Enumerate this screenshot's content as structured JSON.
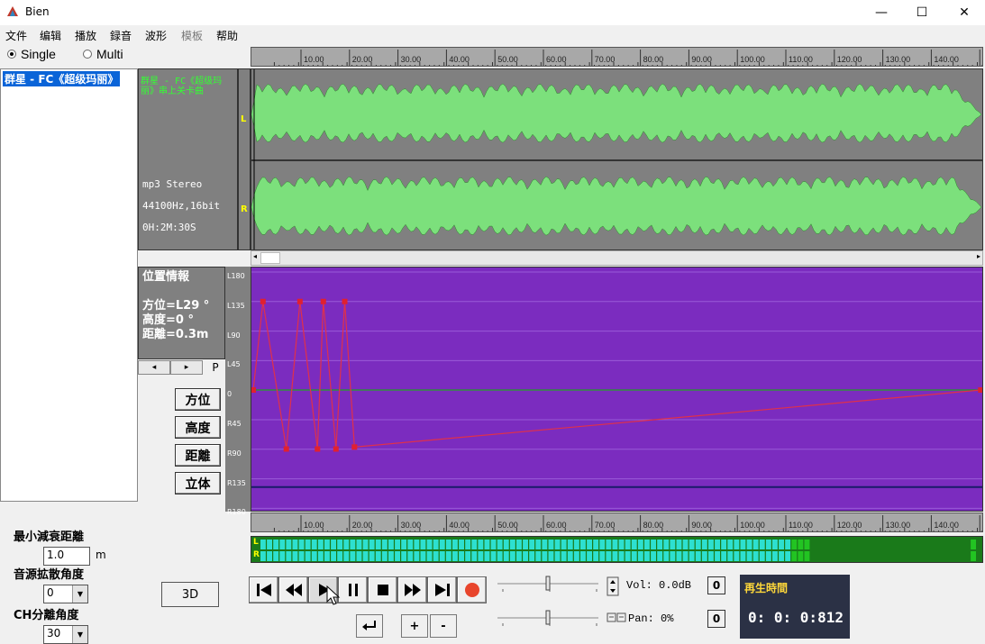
{
  "window": {
    "title": "Bien",
    "minimize": "—",
    "maximize": "☐",
    "close": "✕"
  },
  "menu": [
    "文件",
    "编辑",
    "播放",
    "録音",
    "波形",
    "模板",
    "帮助"
  ],
  "mode": {
    "single": "Single",
    "multi": "Multi",
    "selected": "single"
  },
  "file_list": {
    "items": [
      "群星 - FC《超级玛丽》"
    ]
  },
  "track_info": {
    "title": "群星 - FC《超级玛丽》串上关卡曲",
    "format": "mp3 Stereo",
    "rate": "44100Hz,16bit",
    "duration": "0H:2M:30S"
  },
  "channels": {
    "left": "L",
    "right": "R"
  },
  "ruler": {
    "ticks": [
      "10.00",
      "20.00",
      "30.00",
      "40.00",
      "50.00",
      "60.00",
      "70.00",
      "80.00",
      "90.00",
      "100.00",
      "110.00",
      "120.00",
      "130.00",
      "140.00",
      "15"
    ]
  },
  "position_info": {
    "title": "位置情報",
    "azimuth": "方位=L29 °",
    "height": "高度=0 °",
    "distance": "距離=0.3m"
  },
  "position_nav": {
    "prev": "◂",
    "next": "▸",
    "p": "P"
  },
  "side_buttons": {
    "azimuth": "方位",
    "height": "高度",
    "distance": "距離",
    "stereo": "立体"
  },
  "pan_axis": {
    "labels": [
      "L180",
      "L135",
      "L90",
      "L45",
      "0",
      "R45",
      "R90",
      "R135",
      "R180"
    ]
  },
  "pan_points": [
    {
      "t": 0.0,
      "deg": 0
    },
    {
      "t": 2.0,
      "deg": -135
    },
    {
      "t": 6.8,
      "deg": 90
    },
    {
      "t": 9.6,
      "deg": -135
    },
    {
      "t": 13.2,
      "deg": 90
    },
    {
      "t": 14.4,
      "deg": -135
    },
    {
      "t": 17.0,
      "deg": 90
    },
    {
      "t": 18.8,
      "deg": -135
    },
    {
      "t": 20.8,
      "deg": 87
    },
    {
      "t": 149.5,
      "deg": 0
    }
  ],
  "meter": {
    "left": "L",
    "right": "R",
    "level": 0.74
  },
  "controls": {
    "min_distance_label": "最小減衰距離",
    "min_distance_value": "1.0",
    "min_distance_unit": "m",
    "spread_label": "音源拡散角度",
    "spread_value": "0",
    "ch_angle_label": "CH分離角度",
    "ch_angle_value": "30",
    "btn_3d": "3D"
  },
  "transport": {
    "plus": "+",
    "minus": "-"
  },
  "volume": {
    "label": "Vol: 0.0dB",
    "reset": "0",
    "level": 0.5
  },
  "pan": {
    "label": "Pan: 0%",
    "reset": "0",
    "level": 0.5
  },
  "playback_time": {
    "title": "再生時間",
    "value": "0: 0: 0:812"
  },
  "colors": {
    "wave_green": "#7ce07c",
    "panel_purple": "#7b2cbf",
    "meter_cyan": "#2de0d0",
    "curve_red": "#e0304a"
  }
}
